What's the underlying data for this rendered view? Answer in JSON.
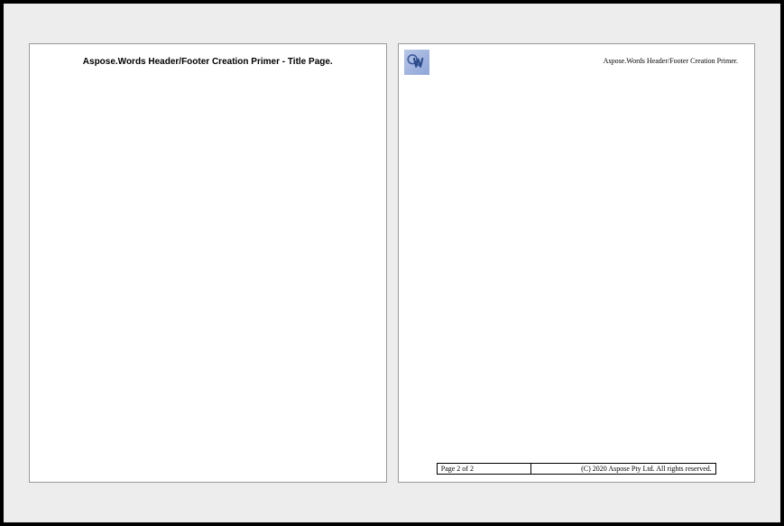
{
  "page1": {
    "header_title": "Aspose.Words Header/Footer Creation Primer - Title Page."
  },
  "page2": {
    "header_title": "Aspose.Words Header/Footer Creation Primer.",
    "footer": {
      "page_info": "Page 2 of 2",
      "copyright": "(C) 2020 Aspose Pty Ltd. All rights reserved."
    }
  }
}
